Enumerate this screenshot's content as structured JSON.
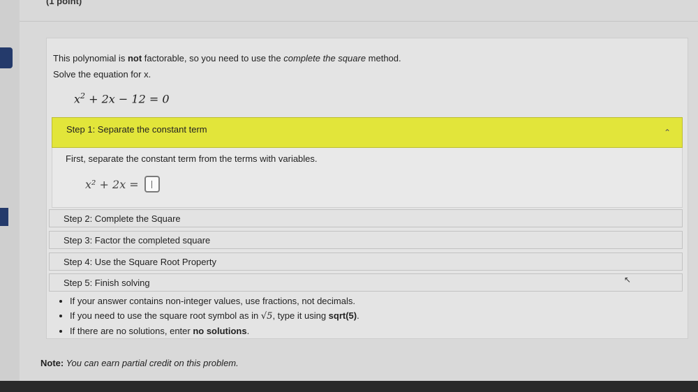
{
  "header": {
    "points_label": "(1 point)"
  },
  "problem": {
    "intro_pre": "This polynomial is ",
    "intro_bold": "not",
    "intro_mid": " factorable, so you need to use the ",
    "intro_italic": "complete the square",
    "intro_post": " method.",
    "solve_prompt": "Solve the equation for x.",
    "equation": {
      "lhs_base": "x",
      "exponent": "2",
      "rest": "+ 2x − 12 = 0"
    }
  },
  "steps": [
    {
      "label": "Step 1: Separate the constant term",
      "expanded": true,
      "instruction": "First, separate the constant term from the terms with variables.",
      "equation_lhs": "x² + 2x =",
      "answer_value": ""
    },
    {
      "label": "Step 2: Complete the Square",
      "expanded": false
    },
    {
      "label": "Step 3: Factor the completed square",
      "expanded": false
    },
    {
      "label": "Step 4: Use the Square Root Property",
      "expanded": false
    },
    {
      "label": "Step 5: Finish solving",
      "expanded": false
    }
  ],
  "tips": {
    "tip1": "If your answer contains non-integer values, use fractions, not decimals.",
    "tip2_pre": "If you need to use the square root symbol as in ",
    "tip2_symbol": "√5",
    "tip2_mid": ", type it using ",
    "tip2_bold": "sqrt(5)",
    "tip2_post": ".",
    "tip3_pre": "If there are no solutions, enter ",
    "tip3_bold": "no solutions",
    "tip3_post": "."
  },
  "note": {
    "bold": "Note:",
    "text": " You can earn partial credit on this problem."
  },
  "icons": {
    "collapse": "chevron-up-icon",
    "pointer": "cursor-icon"
  },
  "colors": {
    "active_step": "#e2e53a"
  }
}
